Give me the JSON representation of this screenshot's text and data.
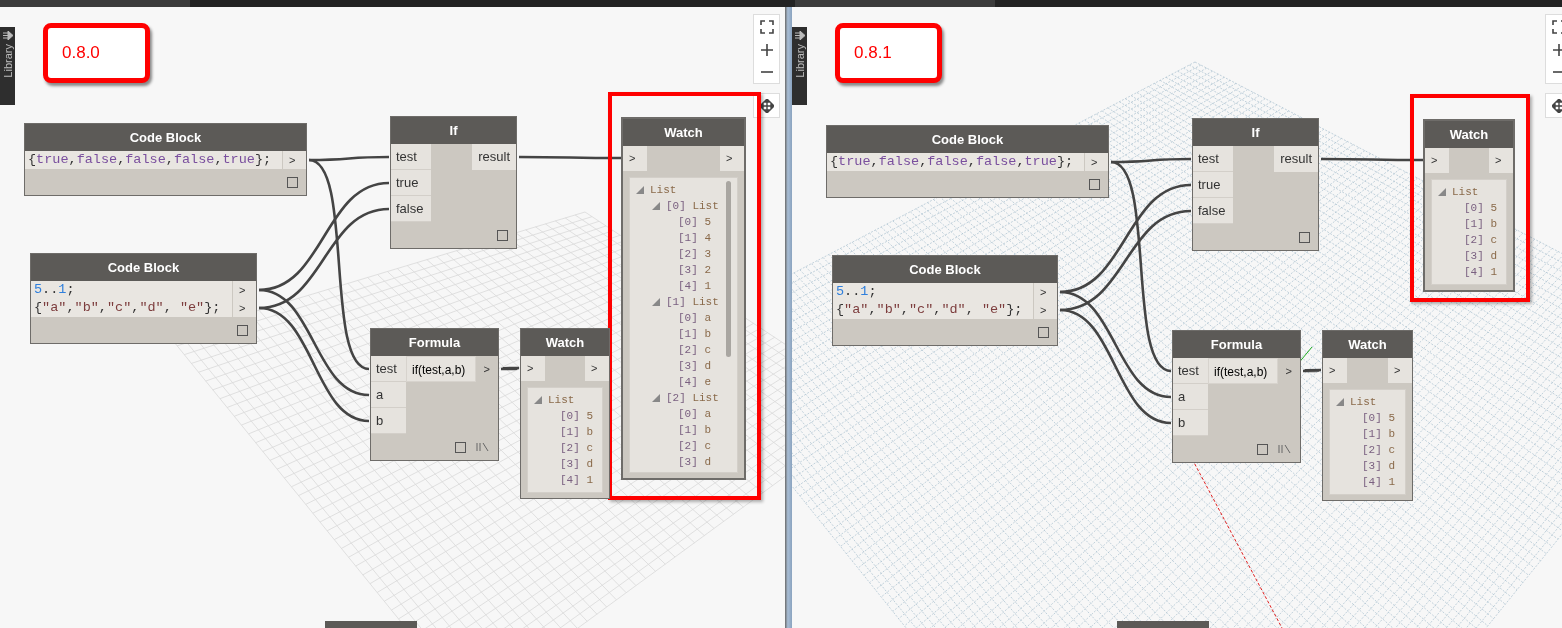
{
  "panels": [
    {
      "version": "0.8.0",
      "library_tab": "Library",
      "nodes": [
        {
          "kind": "code",
          "title": "Code Block",
          "lines": [
            "{true,false,false,false,true};"
          ],
          "outputs": [
            ">"
          ]
        },
        {
          "kind": "function",
          "title": "If",
          "inputs": [
            "test",
            "true",
            "false"
          ],
          "outputs": [
            "result"
          ]
        },
        {
          "kind": "code",
          "title": "Code Block",
          "lines": [
            "5..1;",
            "{\"a\",\"b\",\"c\",\"d\", \"e\"};"
          ],
          "outputs": [
            ">",
            ">"
          ]
        },
        {
          "kind": "formula",
          "title": "Formula",
          "inputs": [
            "test",
            "a",
            "b"
          ],
          "expression": "if(test,a,b)",
          "outputs": [
            ">"
          ]
        },
        {
          "kind": "watch",
          "title": "Watch",
          "inputs": [
            ">"
          ],
          "outputs": [
            ">"
          ],
          "highlighted": false,
          "tree": {
            "label": "List",
            "expanded": true,
            "children": [
              {
                "index": "[0]",
                "value": "5"
              },
              {
                "index": "[1]",
                "value": "b"
              },
              {
                "index": "[2]",
                "value": "c"
              },
              {
                "index": "[3]",
                "value": "d"
              },
              {
                "index": "[4]",
                "value": "1"
              }
            ]
          }
        },
        {
          "kind": "watch",
          "title": "Watch",
          "inputs": [
            ">"
          ],
          "outputs": [
            ">"
          ],
          "highlighted": true,
          "tree": {
            "label": "List",
            "expanded": true,
            "children": [
              {
                "index": "[0]",
                "label": "List",
                "expanded": true,
                "children": [
                  {
                    "index": "[0]",
                    "value": "5"
                  },
                  {
                    "index": "[1]",
                    "value": "4"
                  },
                  {
                    "index": "[2]",
                    "value": "3"
                  },
                  {
                    "index": "[3]",
                    "value": "2"
                  },
                  {
                    "index": "[4]",
                    "value": "1"
                  }
                ]
              },
              {
                "index": "[1]",
                "label": "List",
                "expanded": true,
                "children": [
                  {
                    "index": "[0]",
                    "value": "a"
                  },
                  {
                    "index": "[1]",
                    "value": "b"
                  },
                  {
                    "index": "[2]",
                    "value": "c"
                  },
                  {
                    "index": "[3]",
                    "value": "d"
                  },
                  {
                    "index": "[4]",
                    "value": "e"
                  }
                ]
              },
              {
                "index": "[2]",
                "label": "List",
                "expanded": true,
                "children": [
                  {
                    "index": "[0]",
                    "value": "a"
                  },
                  {
                    "index": "[1]",
                    "value": "b"
                  },
                  {
                    "index": "[2]",
                    "value": "c"
                  },
                  {
                    "index": "[3]",
                    "value": "d"
                  }
                ]
              }
            ]
          }
        }
      ]
    },
    {
      "version": "0.8.1",
      "library_tab": "Library",
      "nodes": [
        {
          "kind": "code",
          "title": "Code Block",
          "lines": [
            "{true,false,false,false,true};"
          ],
          "outputs": [
            ">"
          ]
        },
        {
          "kind": "function",
          "title": "If",
          "inputs": [
            "test",
            "true",
            "false"
          ],
          "outputs": [
            "result"
          ]
        },
        {
          "kind": "code",
          "title": "Code Block",
          "lines": [
            "5..1;",
            "{\"a\",\"b\",\"c\",\"d\", \"e\"};"
          ],
          "outputs": [
            ">",
            ">"
          ]
        },
        {
          "kind": "formula",
          "title": "Formula",
          "inputs": [
            "test",
            "a",
            "b"
          ],
          "expression": "if(test,a,b)",
          "outputs": [
            ">"
          ]
        },
        {
          "kind": "watch",
          "title": "Watch",
          "inputs": [
            ">"
          ],
          "outputs": [
            ">"
          ],
          "highlighted": false,
          "tree": {
            "label": "List",
            "expanded": true,
            "children": [
              {
                "index": "[0]",
                "value": "5"
              },
              {
                "index": "[1]",
                "value": "b"
              },
              {
                "index": "[2]",
                "value": "c"
              },
              {
                "index": "[3]",
                "value": "d"
              },
              {
                "index": "[4]",
                "value": "1"
              }
            ]
          }
        },
        {
          "kind": "watch",
          "title": "Watch",
          "inputs": [
            ">"
          ],
          "outputs": [
            ">"
          ],
          "highlighted": true,
          "tree": {
            "label": "List",
            "expanded": true,
            "children": [
              {
                "index": "[0]",
                "value": "5"
              },
              {
                "index": "[1]",
                "value": "b"
              },
              {
                "index": "[2]",
                "value": "c"
              },
              {
                "index": "[3]",
                "value": "d"
              },
              {
                "index": "[4]",
                "value": "1"
              }
            ]
          }
        }
      ]
    }
  ]
}
